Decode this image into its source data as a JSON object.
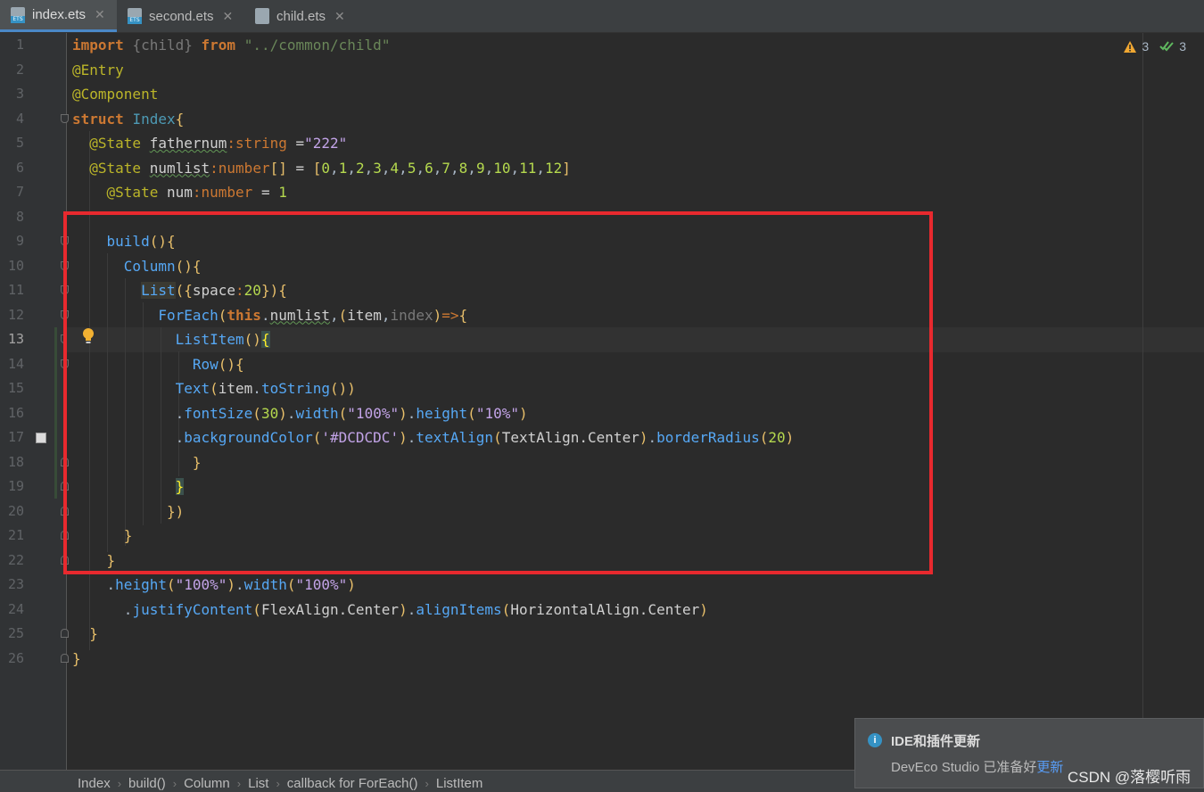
{
  "tabs": [
    {
      "label": "index.ets",
      "active": true
    },
    {
      "label": "second.ets",
      "active": false
    },
    {
      "label": "child.ets",
      "active": false
    }
  ],
  "tab_close_glyph": "✕",
  "inspections": {
    "warnings": "3",
    "ok": "3"
  },
  "line_numbers": [
    "1",
    "2",
    "3",
    "4",
    "5",
    "6",
    "7",
    "8",
    "9",
    "10",
    "11",
    "12",
    "13",
    "14",
    "15",
    "16",
    "17",
    "18",
    "19",
    "20",
    "21",
    "22",
    "23",
    "24",
    "25",
    "26"
  ],
  "current_line": "13",
  "breadcrumbs": [
    "Index",
    "build()",
    "Column",
    "List",
    "callback for ForEach()",
    "ListItem"
  ],
  "notification": {
    "title": "IDE和插件更新",
    "body": "DevEco Studio 已准备好",
    "link": "更新"
  },
  "watermark": "CSDN @落樱听雨",
  "colors": {
    "highlight_box": "#e8292e",
    "editor_bg": "#2b2b2b",
    "accent": "#4a88c7"
  }
}
